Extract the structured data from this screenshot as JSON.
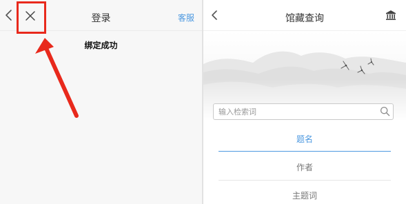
{
  "left": {
    "header": {
      "title": "登录",
      "service_label": "客服",
      "back_icon": "chevron-left-icon",
      "close_icon": "close-icon"
    },
    "message": "绑定成功",
    "highlight_color": "#e8291c"
  },
  "right": {
    "header": {
      "title": "馆藏查询",
      "back_icon": "chevron-left-icon",
      "library_icon": "library-building-icon"
    },
    "search": {
      "placeholder": "输入检索词",
      "value": ""
    },
    "search_fields": [
      {
        "label": "题名",
        "selected": true
      },
      {
        "label": "作者",
        "selected": false
      },
      {
        "label": "主题词",
        "selected": false
      }
    ],
    "accent_color": "#4d99e0"
  }
}
